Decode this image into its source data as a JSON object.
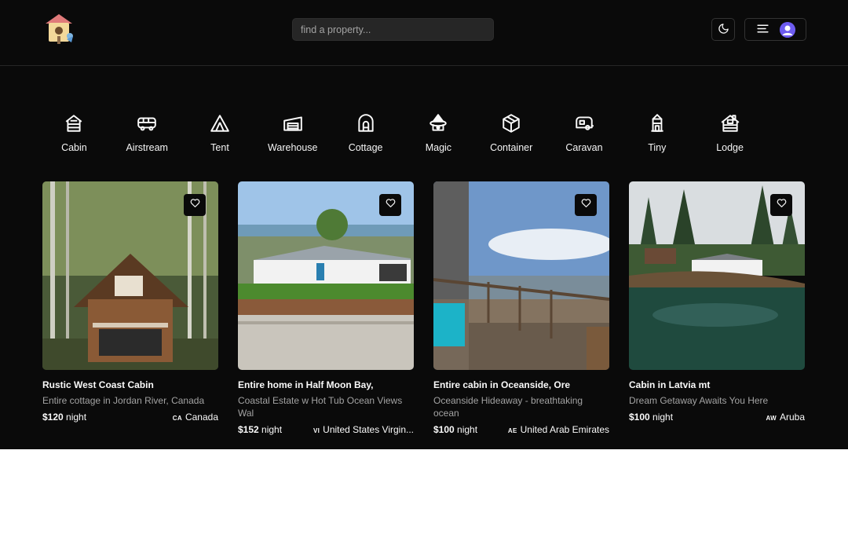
{
  "header": {
    "search_placeholder": "find a property...",
    "theme_icon": "moon-icon",
    "menu_icon": "menu-lines-icon",
    "avatar_color": "#6d5bf0"
  },
  "categories": [
    {
      "label": "Cabin",
      "icon": "cabin-icon"
    },
    {
      "label": "Airstream",
      "icon": "airstream-icon"
    },
    {
      "label": "Tent",
      "icon": "tent-icon"
    },
    {
      "label": "Warehouse",
      "icon": "warehouse-icon"
    },
    {
      "label": "Cottage",
      "icon": "cottage-icon"
    },
    {
      "label": "Magic",
      "icon": "magic-icon"
    },
    {
      "label": "Container",
      "icon": "container-icon"
    },
    {
      "label": "Caravan",
      "icon": "caravan-icon"
    },
    {
      "label": "Tiny",
      "icon": "tiny-icon"
    },
    {
      "label": "Lodge",
      "icon": "lodge-icon"
    }
  ],
  "properties": [
    {
      "title": "Rustic West Coast Cabin",
      "description": "Entire cottage in Jordan River, Canada",
      "price": "$120",
      "unit": "night",
      "country_code": "CA",
      "country": "Canada"
    },
    {
      "title": "Entire home in Half Moon Bay,",
      "description": "Coastal Estate w Hot Tub Ocean Views Wal",
      "price": "$152",
      "unit": "night",
      "country_code": "VI",
      "country": "United States Virgin..."
    },
    {
      "title": "Entire cabin in Oceanside, Ore",
      "description": "Oceanside Hideaway - breathtaking ocean",
      "price": "$100",
      "unit": "night",
      "country_code": "AE",
      "country": "United Arab Emirates"
    },
    {
      "title": "Cabin in Latvia mt",
      "description": "Dream Getaway Awaits You Here",
      "price": "$100",
      "unit": "night",
      "country_code": "AW",
      "country": "Aruba"
    }
  ],
  "colors": {
    "background": "#0a0a0a",
    "surface": "#262626",
    "muted_text": "#a3a3a3"
  }
}
